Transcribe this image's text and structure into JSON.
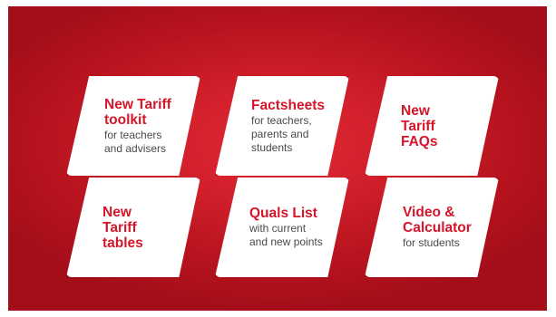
{
  "colors": {
    "background": "#c8141f",
    "tile": "#ffffff",
    "title": "#d5152a",
    "subtitle": "#4a4a4a"
  },
  "tiles": [
    {
      "title": "New Tariff\ntoolkit",
      "subtitle": "for teachers\nand advisers"
    },
    {
      "title": "Factsheets",
      "subtitle": "for teachers,\nparents and\nstudents"
    },
    {
      "title": "New\nTariff\nFAQs",
      "subtitle": ""
    },
    {
      "title": "New\nTariff\ntables",
      "subtitle": ""
    },
    {
      "title": "Quals List",
      "subtitle": "with current\nand new points"
    },
    {
      "title": "Video &\nCalculator",
      "subtitle": "for students"
    }
  ]
}
